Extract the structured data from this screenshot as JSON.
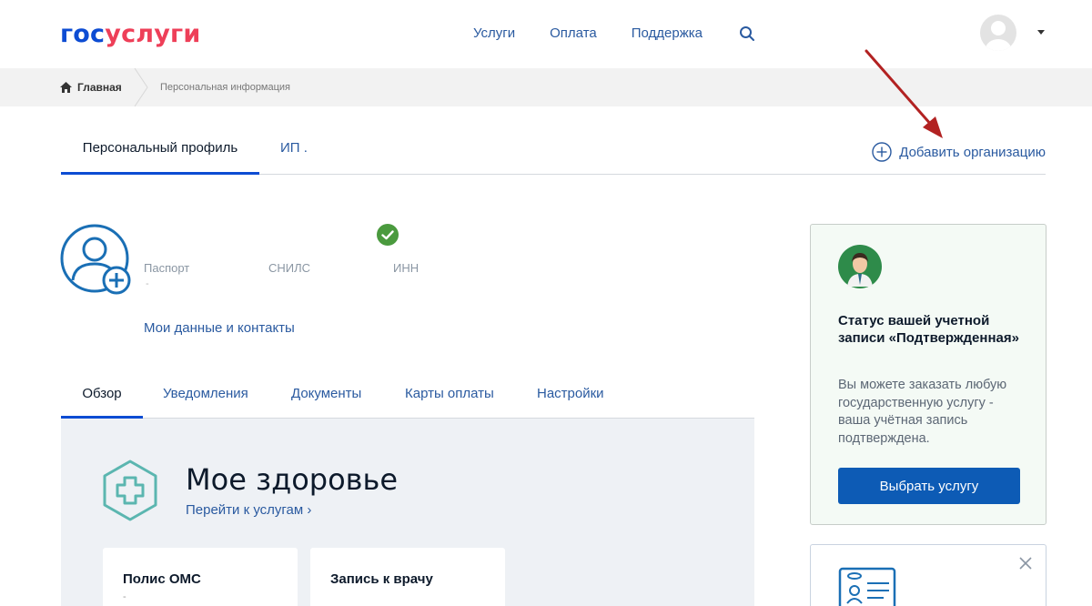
{
  "header": {
    "logo_part1": "гос",
    "logo_part2": "услуги",
    "nav": [
      "Услуги",
      "Оплата",
      "Поддержка"
    ]
  },
  "breadcrumb": {
    "home": "Главная",
    "current": "Персональная информация"
  },
  "profile_tabs": {
    "personal": "Персональный профиль",
    "ip": "ИП .",
    "add_org": "Добавить организацию"
  },
  "profile": {
    "passport": "Паспорт",
    "passport_value": "-",
    "snils": "СНИЛС",
    "inn": "ИНН",
    "my_data_link": "Мои данные и контакты"
  },
  "main_tabs": [
    "Обзор",
    "Уведомления",
    "Документы",
    "Карты оплаты",
    "Настройки"
  ],
  "health": {
    "title": "Мое здоровье",
    "link": "Перейти к услугам",
    "cards": [
      {
        "title": "Полис ОМС",
        "value": "-"
      },
      {
        "title": "Запись к врачу",
        "value": ""
      }
    ]
  },
  "status_card": {
    "title": "Статус вашей учетной записи «Подтвержденная»",
    "text": "Вы можете заказать любую государственную услугу - ваша учётная запись подтверждена.",
    "button": "Выбрать услугу"
  },
  "colors": {
    "brand_blue": "#0d4cd3",
    "brand_red": "#ee3f58",
    "link": "#2a5aa0",
    "button": "#0d5bb5",
    "check_green": "#4a9a3e",
    "annotation_arrow": "#b22222"
  },
  "icons": {
    "search": "search-icon",
    "home": "home-icon",
    "add_circle": "plus-circle-icon",
    "user_add": "user-add-icon",
    "check": "check-circle-icon",
    "health": "medical-cross-icon",
    "support_avatar": "support-agent-icon",
    "id_card": "id-card-icon",
    "close": "close-icon"
  }
}
